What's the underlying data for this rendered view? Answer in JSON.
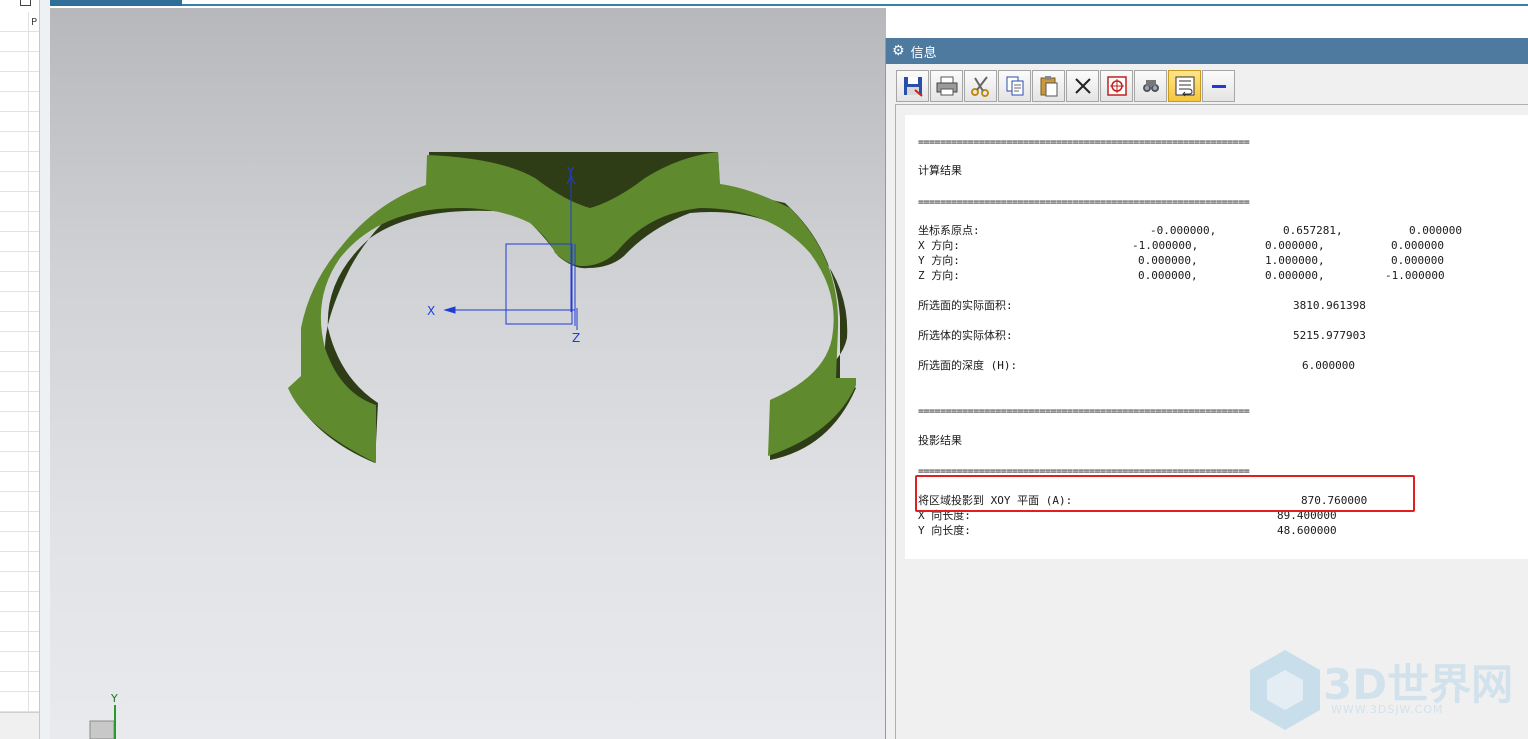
{
  "left_panel": {
    "column_label": "P"
  },
  "viewport": {
    "axis_labels": {
      "x": "X",
      "y": "Y",
      "z": "Z"
    },
    "mini_triad": {
      "y": "Y"
    },
    "part_color": "#5f8a2e",
    "axis_color": "#1f3dd6"
  },
  "info_panel": {
    "title": "信息",
    "toolbar": [
      {
        "name": "save-icon"
      },
      {
        "name": "print-icon"
      },
      {
        "name": "cut-icon"
      },
      {
        "name": "copy-icon"
      },
      {
        "name": "paste-icon"
      },
      {
        "name": "delete-icon"
      },
      {
        "name": "target-icon"
      },
      {
        "name": "find-icon"
      },
      {
        "name": "wrap-icon"
      },
      {
        "name": "minimize-icon"
      }
    ],
    "separator": "============================================================",
    "section1_title": "计算结果",
    "origin": {
      "label": "坐标系原点:",
      "v1": "-0.000000,",
      "v2": "0.657281,",
      "v3": "0.000000"
    },
    "x_dir": {
      "label": "X 方向:",
      "v1": "-1.000000,",
      "v2": "0.000000,",
      "v3": "0.000000"
    },
    "y_dir": {
      "label": "Y 方向:",
      "v1": "0.000000,",
      "v2": "1.000000,",
      "v3": "0.000000"
    },
    "z_dir": {
      "label": "Z 方向:",
      "v1": "0.000000,",
      "v2": "0.000000,",
      "v3": "-1.000000"
    },
    "area": {
      "label": "所选面的实际面积:",
      "value": "3810.961398"
    },
    "volume": {
      "label": "所选体的实际体积:",
      "value": "5215.977903"
    },
    "depth": {
      "label": "所选面的深度 (H):",
      "value": "6.000000"
    },
    "section2_title": "投影结果",
    "projection": {
      "label": "将区域投影到 XOY 平面 (A):",
      "value": "870.760000"
    },
    "x_len": {
      "label": "X 向长度:",
      "value": "89.400000"
    },
    "y_len": {
      "label": "Y 向长度:",
      "value": "48.600000"
    }
  },
  "watermark": {
    "text": "3D世界网",
    "sub": "WWW.3DSJW.COM"
  },
  "colors": {
    "highlight": "#e02020",
    "title_bar": "#4f7aa0"
  }
}
